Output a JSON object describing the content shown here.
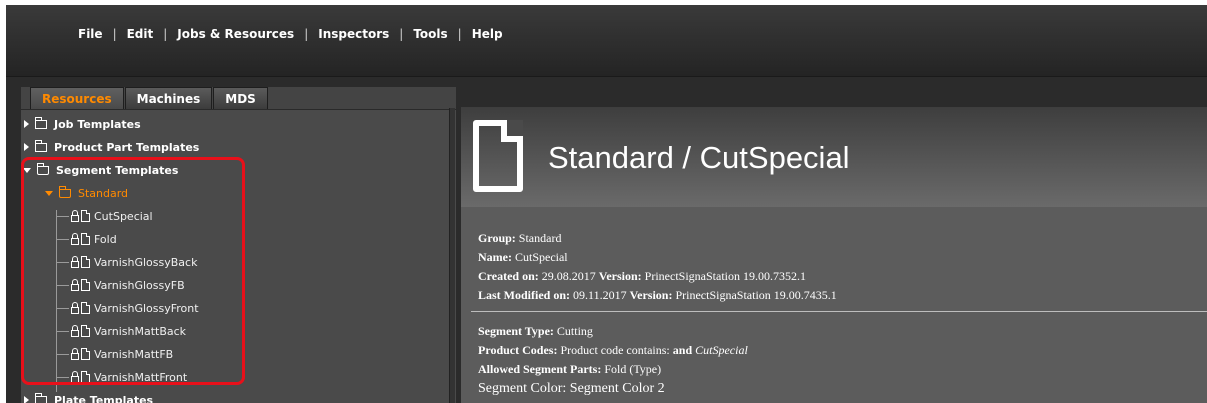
{
  "menu": {
    "items": [
      "File",
      "Edit",
      "Jobs & Resources",
      "Inspectors",
      "Tools",
      "Help"
    ],
    "separator": "|"
  },
  "tabs": [
    {
      "label": "Resources",
      "active": true
    },
    {
      "label": "Machines",
      "active": false
    },
    {
      "label": "MDS",
      "active": false
    }
  ],
  "tree": {
    "job_templates": "Job Templates",
    "product_part_templates": "Product Part Templates",
    "segment_templates": "Segment Templates",
    "standard": "Standard",
    "leaves": [
      "CutSpecial",
      "Fold",
      "VarnishGlossyBack",
      "VarnishGlossyFB",
      "VarnishGlossyFront",
      "VarnishMattBack",
      "VarnishMattFB",
      "VarnishMattFront"
    ],
    "plate_templates": "Plate Templates"
  },
  "detail": {
    "title": "Standard / CutSpecial",
    "group_label": "Group:",
    "group_value": "Standard",
    "name_label": "Name:",
    "name_value": "CutSpecial",
    "created_label": "Created on:",
    "created_value": "29.08.2017",
    "version_label": "Version:",
    "created_version": "PrinectSignaStation 19.00.7352.1",
    "modified_label": "Last Modified on:",
    "modified_value": "09.11.2017",
    "modified_version": "PrinectSignaStation 19.00.7435.1",
    "segment_type_label": "Segment Type:",
    "segment_type_value": "Cutting",
    "product_codes_label": "Product Codes:",
    "product_codes_value": "Product code contains:",
    "product_codes_and": "and",
    "product_codes_code": "CutSpecial",
    "allowed_parts_label": "Allowed Segment Parts:",
    "allowed_parts_value": "Fold (Type)",
    "segment_color_label": "Segment Color:",
    "segment_color_value": "Segment Color 2"
  },
  "colors": {
    "accent": "#ff8a00",
    "highlight": "#e8101a"
  }
}
